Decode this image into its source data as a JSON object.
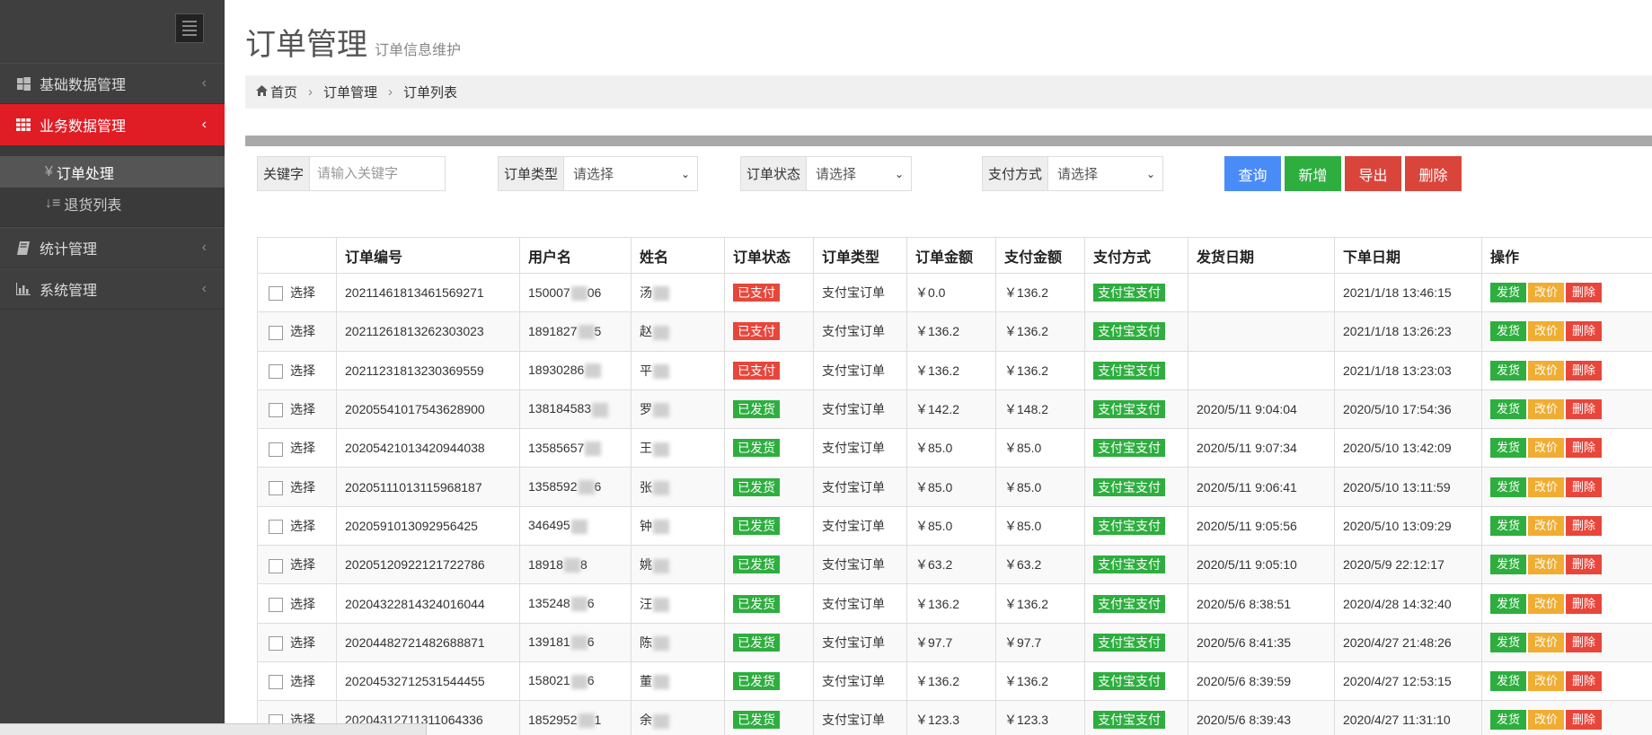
{
  "sidebar": {
    "items": [
      {
        "label": "基础数据管理",
        "icon": "windows-icon",
        "active": false
      },
      {
        "label": "业务数据管理",
        "icon": "grid-icon",
        "active": true
      },
      {
        "label": "统计管理",
        "icon": "book-icon",
        "active": false
      },
      {
        "label": "系统管理",
        "icon": "bar-chart-icon",
        "active": false
      }
    ],
    "submenu": [
      {
        "label": "订单处理",
        "icon_glyph": "¥",
        "active": true
      },
      {
        "label": "退货列表",
        "icon_glyph": "↓≡",
        "active": false
      }
    ]
  },
  "header": {
    "title": "订单管理",
    "subtitle": "订单信息维护"
  },
  "breadcrumb": {
    "home": "首页",
    "level2": "订单管理",
    "level3": "订单列表"
  },
  "filters": {
    "keyword_label": "关键字",
    "keyword_placeholder": "请输入关键字",
    "order_type_label": "订单类型",
    "order_type_value": "请选择",
    "order_status_label": "订单状态",
    "order_status_value": "请选择",
    "pay_method_label": "支付方式",
    "pay_method_value": "请选择"
  },
  "buttons": {
    "query": "查询",
    "add": "新增",
    "export": "导出",
    "delete": "删除"
  },
  "colors": {
    "query": "#4a8cf7",
    "add": "#2eae3f",
    "export": "#d9453a",
    "delete": "#d9453a",
    "accent": "#e01d24"
  },
  "table": {
    "headers": [
      "",
      "订单编号",
      "用户名",
      "姓名",
      "订单状态",
      "订单类型",
      "订单金额",
      "支付金额",
      "支付方式",
      "发货日期",
      "下单日期",
      "操作"
    ],
    "select_label": "选择",
    "actions": {
      "ship": "发货",
      "reprice": "改价",
      "remove": "删除"
    },
    "rows": [
      {
        "order_no": "20211461813461569271",
        "user": "150007",
        "user2": "06",
        "name": "汤",
        "status": "已支付",
        "status_color": "red",
        "type": "支付宝订单",
        "amount": "￥0.0",
        "paid": "￥136.2",
        "method": "支付宝支付",
        "ship_date": "",
        "order_date": "2021/1/18 13:46:15"
      },
      {
        "order_no": "20211261813262303023",
        "user": "1891827",
        "user2": "5",
        "name": "赵",
        "status": "已支付",
        "status_color": "red",
        "type": "支付宝订单",
        "amount": "￥136.2",
        "paid": "￥136.2",
        "method": "支付宝支付",
        "ship_date": "",
        "order_date": "2021/1/18 13:26:23"
      },
      {
        "order_no": "20211231813230369559",
        "user": "18930286",
        "user2": "",
        "name": "平",
        "status": "已支付",
        "status_color": "red",
        "type": "支付宝订单",
        "amount": "￥136.2",
        "paid": "￥136.2",
        "method": "支付宝支付",
        "ship_date": "",
        "order_date": "2021/1/18 13:23:03"
      },
      {
        "order_no": "20205541017543628900",
        "user": "138184583",
        "user2": "",
        "name": "罗",
        "status": "已发货",
        "status_color": "green",
        "type": "支付宝订单",
        "amount": "￥142.2",
        "paid": "￥148.2",
        "method": "支付宝支付",
        "ship_date": "2020/5/11 9:04:04",
        "order_date": "2020/5/10 17:54:36"
      },
      {
        "order_no": "20205421013420944038",
        "user": "13585657",
        "user2": "",
        "name": "王",
        "status": "已发货",
        "status_color": "green",
        "type": "支付宝订单",
        "amount": "￥85.0",
        "paid": "￥85.0",
        "method": "支付宝支付",
        "ship_date": "2020/5/11 9:07:34",
        "order_date": "2020/5/10 13:42:09"
      },
      {
        "order_no": "20205111013115968187",
        "user": "1358592",
        "user2": "6",
        "name": "张",
        "status": "已发货",
        "status_color": "green",
        "type": "支付宝订单",
        "amount": "￥85.0",
        "paid": "￥85.0",
        "method": "支付宝支付",
        "ship_date": "2020/5/11 9:06:41",
        "order_date": "2020/5/10 13:11:59"
      },
      {
        "order_no": "2020591013092956425",
        "user": "346495",
        "user2": "",
        "name": "钟",
        "status": "已发货",
        "status_color": "green",
        "type": "支付宝订单",
        "amount": "￥85.0",
        "paid": "￥85.0",
        "method": "支付宝支付",
        "ship_date": "2020/5/11 9:05:56",
        "order_date": "2020/5/10 13:09:29"
      },
      {
        "order_no": "20205120922121722786",
        "user": "18918",
        "user2": "8",
        "name": "姚",
        "status": "已发货",
        "status_color": "green",
        "type": "支付宝订单",
        "amount": "￥63.2",
        "paid": "￥63.2",
        "method": "支付宝支付",
        "ship_date": "2020/5/11 9:05:10",
        "order_date": "2020/5/9 22:12:17"
      },
      {
        "order_no": "20204322814324016044",
        "user": "135248",
        "user2": "6",
        "name": "汪",
        "status": "已发货",
        "status_color": "green",
        "type": "支付宝订单",
        "amount": "￥136.2",
        "paid": "￥136.2",
        "method": "支付宝支付",
        "ship_date": "2020/5/6 8:38:51",
        "order_date": "2020/4/28 14:32:40"
      },
      {
        "order_no": "20204482721482688871",
        "user": "139181",
        "user2": "6",
        "name": "陈",
        "status": "已发货",
        "status_color": "green",
        "type": "支付宝订单",
        "amount": "￥97.7",
        "paid": "￥97.7",
        "method": "支付宝支付",
        "ship_date": "2020/5/6 8:41:35",
        "order_date": "2020/4/27 21:48:26"
      },
      {
        "order_no": "20204532712531544455",
        "user": "158021",
        "user2": "6",
        "name": "董",
        "status": "已发货",
        "status_color": "green",
        "type": "支付宝订单",
        "amount": "￥136.2",
        "paid": "￥136.2",
        "method": "支付宝支付",
        "ship_date": "2020/5/6 8:39:59",
        "order_date": "2020/4/27 12:53:15"
      },
      {
        "order_no": "20204312711311064336",
        "user": "1852952",
        "user2": "1",
        "name": "余",
        "status": "已发货",
        "status_color": "green",
        "type": "支付宝订单",
        "amount": "￥123.3",
        "paid": "￥123.3",
        "method": "支付宝支付",
        "ship_date": "2020/5/6 8:39:43",
        "order_date": "2020/4/27 11:31:10"
      }
    ]
  }
}
